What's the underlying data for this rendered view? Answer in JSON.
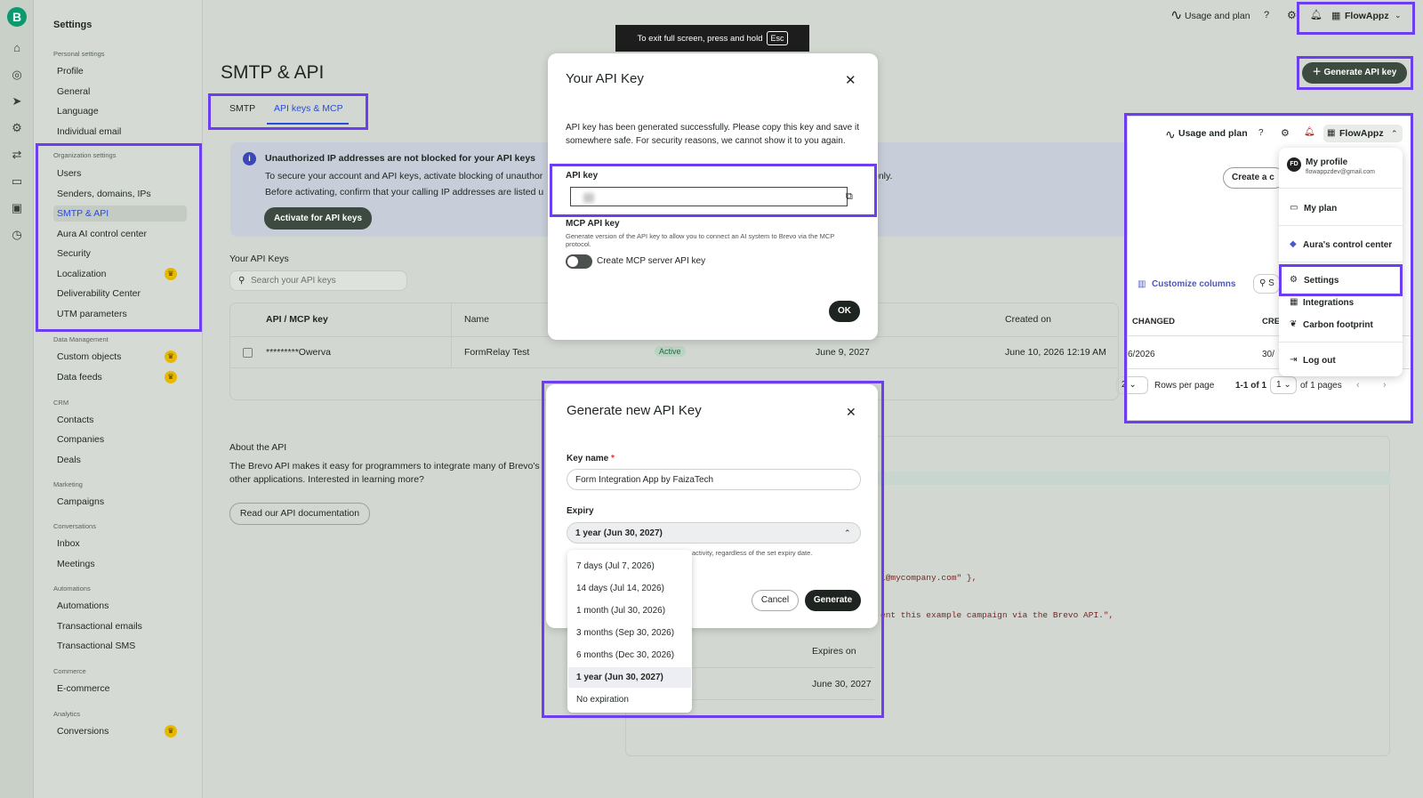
{
  "rail": {
    "logo": "B",
    "icons": [
      "home-icon",
      "contacts-icon",
      "send-icon",
      "automation-icon",
      "sync-icon",
      "chat-icon",
      "calendar-icon",
      "clock-icon"
    ]
  },
  "sidebar": {
    "title": "Settings",
    "groups": [
      {
        "label": "Personal settings",
        "items": [
          "Profile",
          "General",
          "Language",
          "Individual email"
        ]
      },
      {
        "label": "Organization settings",
        "items": [
          "Users",
          "Senders, domains, IPs",
          "SMTP & API",
          "Aura AI control center",
          "Security",
          "Localization",
          "Deliverability Center",
          "UTM parameters"
        ]
      },
      {
        "label": "Data Management",
        "items": [
          "Custom objects",
          "Data feeds"
        ]
      },
      {
        "label": "CRM",
        "items": [
          "Contacts",
          "Companies",
          "Deals"
        ]
      },
      {
        "label": "Marketing",
        "items": [
          "Campaigns"
        ]
      },
      {
        "label": "Conversations",
        "items": [
          "Inbox",
          "Meetings"
        ]
      },
      {
        "label": "Automations",
        "items": [
          "Automations",
          "Transactional emails",
          "Transactional SMS"
        ]
      },
      {
        "label": "Commerce",
        "items": [
          "E-commerce"
        ]
      },
      {
        "label": "Analytics",
        "items": [
          "Conversions"
        ]
      }
    ]
  },
  "topbar": {
    "usage": "Usage and plan",
    "account": "FlowAppz"
  },
  "fullscreen": {
    "text": "To exit full screen, press and hold",
    "key": "Esc"
  },
  "page": {
    "title": "SMTP & API",
    "tabs": [
      "SMTP",
      "API keys & MCP"
    ],
    "generate_button": "Generate API key"
  },
  "banner": {
    "title": "Unauthorized IP addresses are not blocked for your API keys",
    "line1": "To secure your account and API keys, activate blocking of unauthor",
    "line1_end": "only.",
    "line2": "Before activating, confirm that your calling IP addresses are listed u",
    "button": "Activate for API keys"
  },
  "keys": {
    "heading": "Your API Keys",
    "search_placeholder": "Search your API keys",
    "columns": [
      "API / MCP key",
      "Name",
      "Created on"
    ],
    "row": {
      "key": "*********Owerva",
      "name": "FormRelay Test",
      "status": "Active",
      "expires": "June 9, 2027",
      "created": "June 10, 2026 12:19 AM"
    }
  },
  "about": {
    "heading": "About the API",
    "line1": "The Brevo API makes it easy for programmers to integrate many of Brevo's",
    "line2": "other applications. Interested in learning more?",
    "button": "Read our API documentation"
  },
  "code": {
    "line1": "l@mycompany.com\" },",
    "line2": "ent this example campaign via the Brevo API.\","
  },
  "bottom_table": {
    "expires_header": "Expires on",
    "expires_value": "June 30, 2027",
    "partial": "J    0 2027"
  },
  "api_key_modal": {
    "title": "Your API Key",
    "message": "API key has been generated successfully. Please copy this key and save it somewhere safe. For security reasons, we cannot show it to you again.",
    "api_key_label": "API key",
    "mcp_label": "MCP API key",
    "mcp_desc": "Generate version of the API key to allow you to connect an AI system to Brevo via the MCP protocol.",
    "toggle_label": "Create MCP server API key",
    "ok": "OK"
  },
  "generate_modal": {
    "title": "Generate new API Key",
    "key_name_label": "Key name",
    "required": "*",
    "key_name_value": "Form Integration App by FaizaTech",
    "expiry_label": "Expiry",
    "expiry_value": "1 year (Jun 30, 2027)",
    "hint": "activity, regardless of the set expiry date.",
    "options": [
      "7 days (Jul 7, 2026)",
      "14 days (Jul 14, 2026)",
      "1 month (Jul 30, 2026)",
      "3 months (Sep 30, 2026)",
      "6 months (Dec 30, 2026)",
      "1 year (Jun 30, 2027)",
      "No expiration"
    ],
    "cancel": "Cancel",
    "generate": "Generate"
  },
  "inset": {
    "usage": "Usage and plan",
    "account": "FlowAppz",
    "create": "Create a c",
    "customize": "Customize columns",
    "search_stub": "S",
    "col_changed": "CHANGED",
    "col_cre": "CRE",
    "row_date": "6/2026",
    "row_cre": "30/",
    "rows_per_page": "Rows per page",
    "rpp_value": "2",
    "pager": "1-1 of 1",
    "page_num": "1",
    "of_pages": "of 1 pages",
    "menu": {
      "profile": "My profile",
      "email": "flowappzdev@gmail.com",
      "initials": "FD",
      "plan": "My plan",
      "aura": "Aura's control center",
      "settings": "Settings",
      "integrations": "Integrations",
      "carbon": "Carbon footprint",
      "logout": "Log out"
    }
  },
  "colors": {
    "highlight": "#6c3ef0",
    "brand": "#0b996e",
    "link": "#2a4bd6"
  }
}
